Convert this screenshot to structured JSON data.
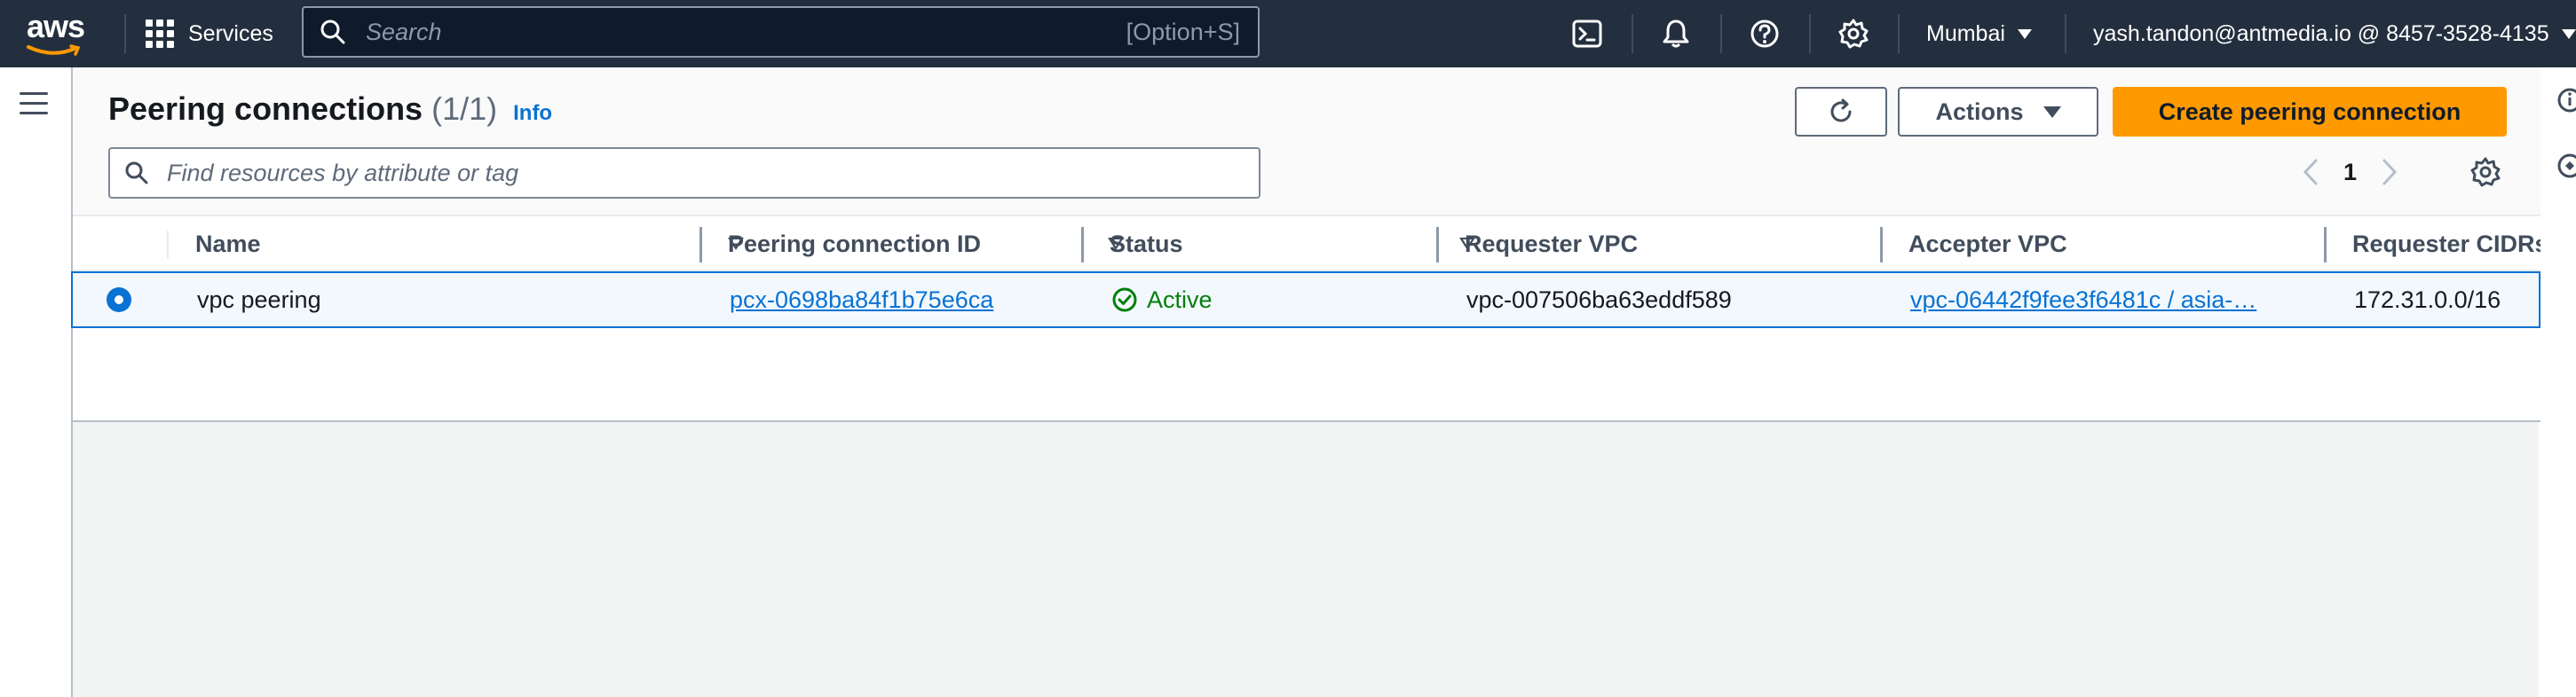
{
  "topnav": {
    "logo_text": "aws",
    "services_label": "Services",
    "search_placeholder": "Search",
    "search_shortcut": "[Option+S]",
    "region_label": "Mumbai",
    "account_label": "yash.tandon@antmedia.io @ 8457-3528-4135"
  },
  "header": {
    "title": "Peering connections",
    "count": "(1/1)",
    "info_label": "Info",
    "actions_label": "Actions",
    "create_label": "Create peering connection"
  },
  "filter": {
    "placeholder": "Find resources by attribute or tag"
  },
  "pagination": {
    "current_page": "1"
  },
  "table": {
    "columns": [
      "Name",
      "Peering connection ID",
      "Status",
      "Requester VPC",
      "Accepter VPC",
      "Requester CIDRs"
    ],
    "rows": [
      {
        "selected": true,
        "name": "vpc peering",
        "peering_id": "pcx-0698ba84f1b75e6ca",
        "status": "Active",
        "requester_vpc": "vpc-007506ba63eddf589",
        "accepter_vpc": "vpc-06442f9fee3f6481c / asia-…",
        "requester_cidrs": "172.31.0.0/16"
      }
    ]
  },
  "colors": {
    "nav_bg": "#232f3e",
    "primary_button": "#ff9900",
    "link": "#0972d3",
    "success": "#037f0c"
  },
  "icons": [
    "aws-logo",
    "services-grid-icon",
    "search-icon",
    "cloudshell-icon",
    "notifications-icon",
    "help-icon",
    "settings-icon",
    "hamburger-icon",
    "refresh-icon",
    "filter-search-icon",
    "chevron-left-icon",
    "chevron-right-icon",
    "preferences-gear-icon",
    "status-check-icon"
  ]
}
